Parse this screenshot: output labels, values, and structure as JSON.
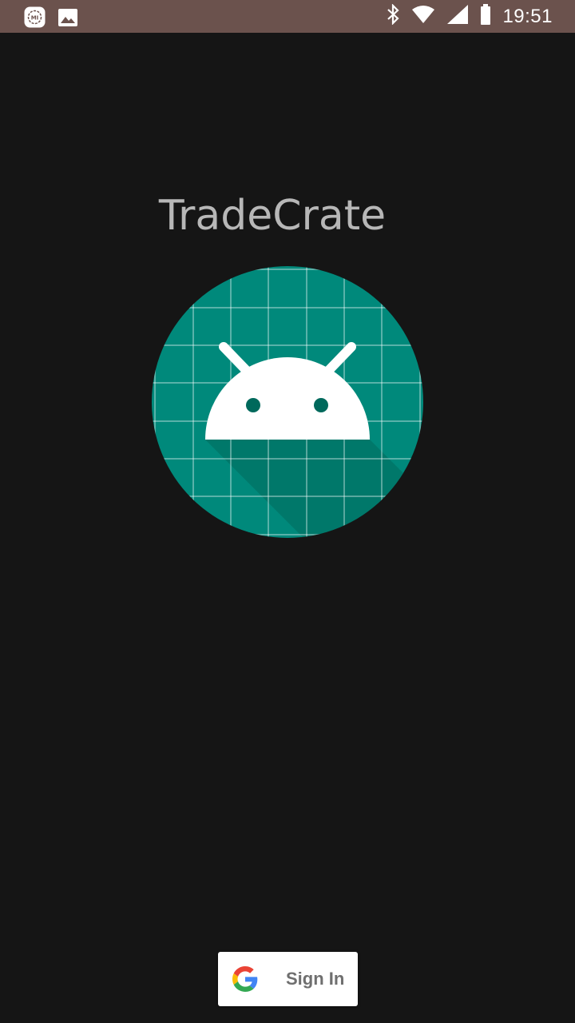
{
  "status_bar": {
    "time": "19:51",
    "icons": [
      "mi-icon",
      "gallery-icon",
      "bluetooth-icon",
      "wifi-icon",
      "signal-icon",
      "battery-icon"
    ],
    "background": "#6b524d"
  },
  "app": {
    "title": "TradeCrate",
    "logo": "android-logo-icon",
    "accent": "#00897b",
    "background": "#151515"
  },
  "signin": {
    "label": "Sign In",
    "icon": "google-icon"
  }
}
